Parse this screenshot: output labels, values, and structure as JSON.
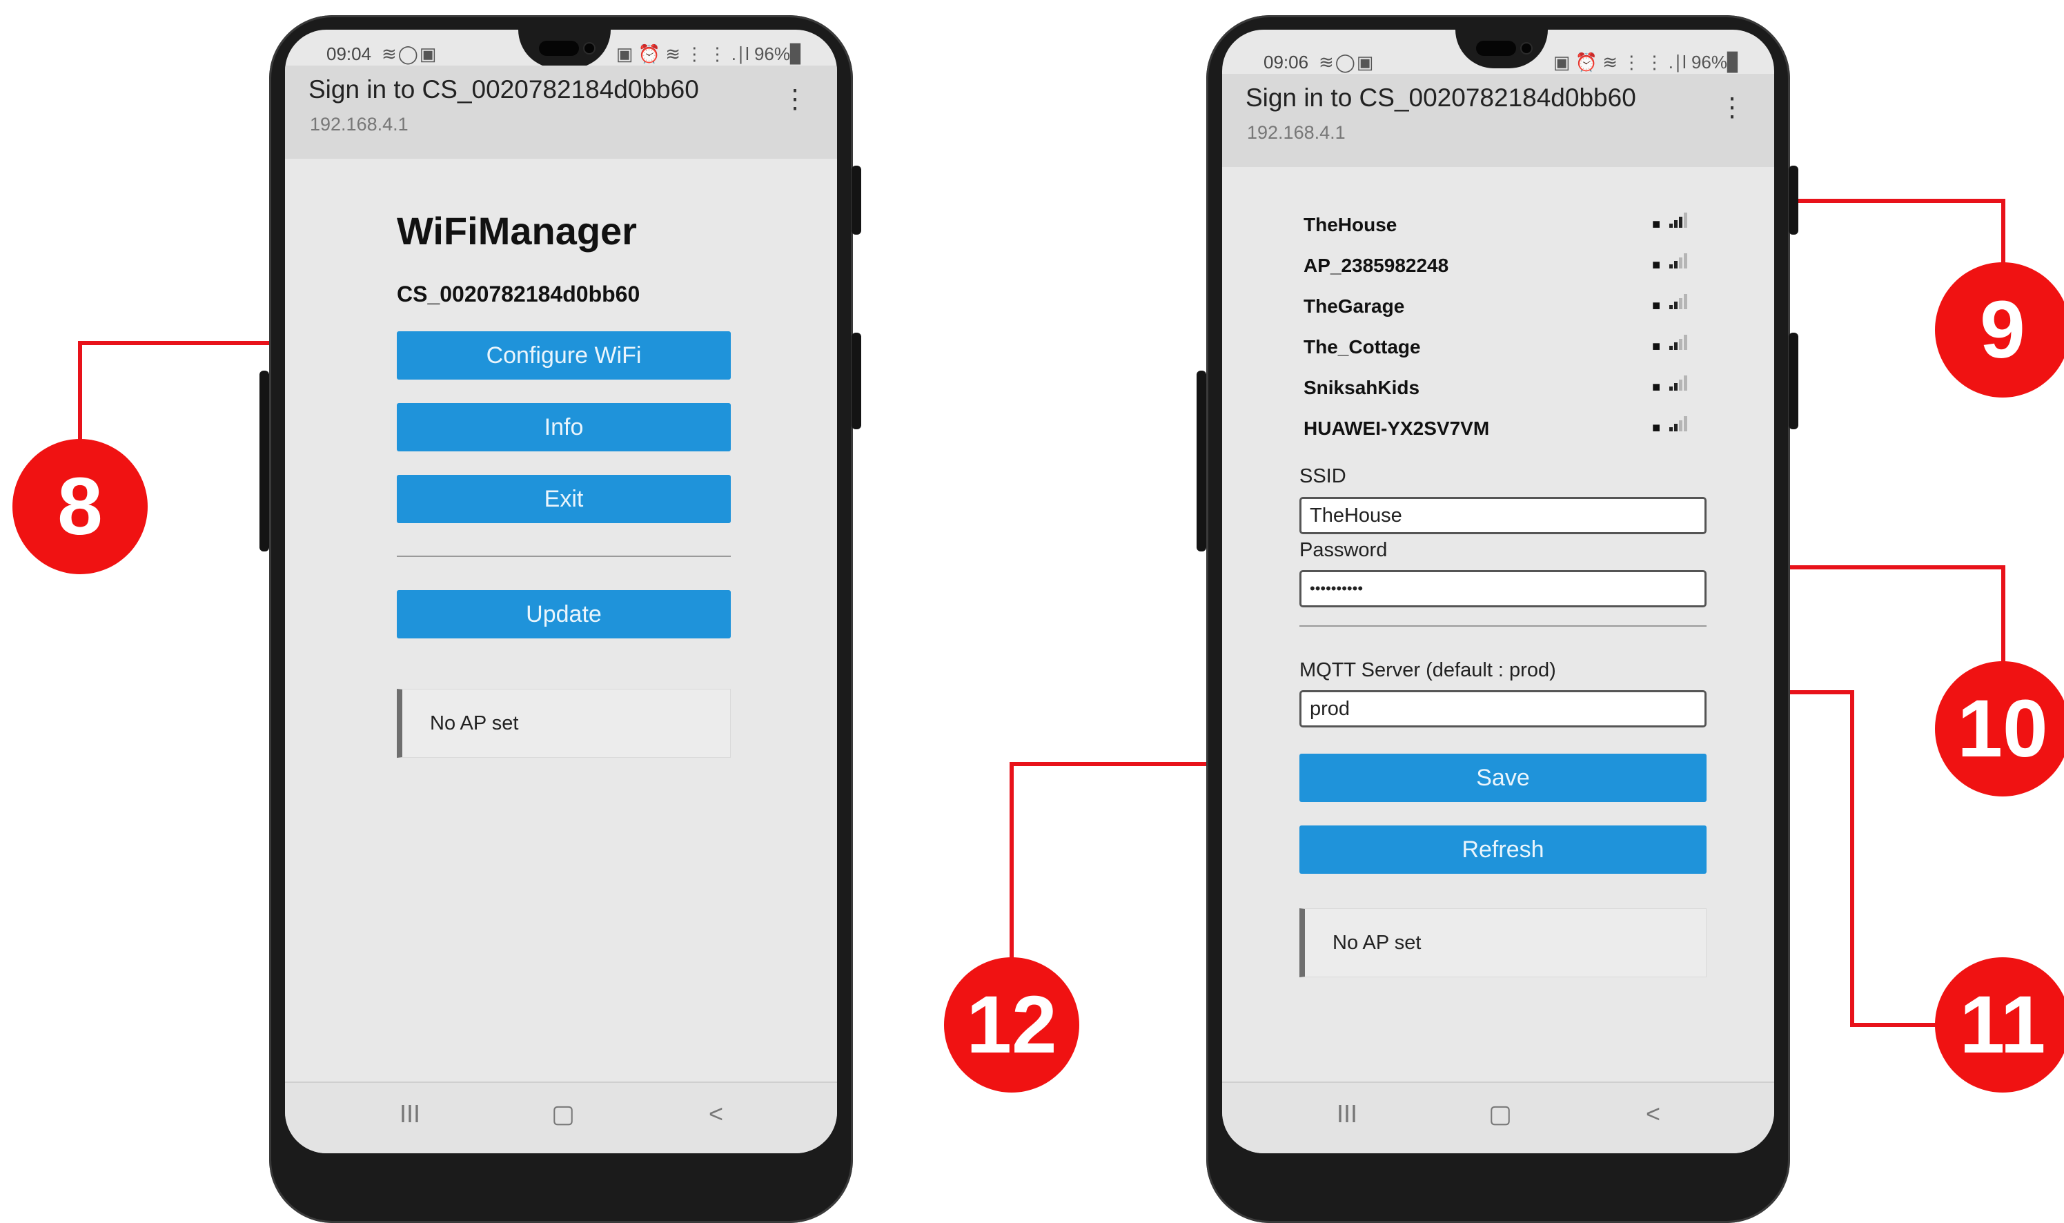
{
  "left_phone": {
    "status": {
      "time": "09:04",
      "icons_left": "≋◯▣",
      "icons_right": "▣ ⏰ ≋ ⋮ ⋮ .∣l 96%▊"
    },
    "address_bar": {
      "title": "Sign in to CS_0020782184d0bb60",
      "url": "192.168.4.1",
      "menu": "⋮"
    },
    "page": {
      "heading": "WiFiManager",
      "device_id": "CS_0020782184d0bb60",
      "buttons": {
        "configure": "Configure WiFi",
        "info": "Info",
        "exit": "Exit",
        "update": "Update"
      },
      "message": "No AP set"
    },
    "nav": {
      "recents": "III",
      "home": "▢",
      "back": "<"
    }
  },
  "right_phone": {
    "status": {
      "time": "09:06",
      "icons_left": "≋◯▣",
      "icons_right": "▣ ⏰ ≋ ⋮ ⋮ .∣l 96%▊"
    },
    "address_bar": {
      "title": "Sign in to CS_0020782184d0bb60",
      "url": "192.168.4.1",
      "menu": "⋮"
    },
    "networks": [
      {
        "name": "TheHouse",
        "signal_bars": 3
      },
      {
        "name": "AP_2385982248",
        "signal_bars": 2
      },
      {
        "name": "TheGarage",
        "signal_bars": 2
      },
      {
        "name": "The_Cottage",
        "signal_bars": 2
      },
      {
        "name": "SniksahKids",
        "signal_bars": 2
      },
      {
        "name": "HUAWEI-YX2SV7VM",
        "signal_bars": 2
      }
    ],
    "form": {
      "ssid_label": "SSID",
      "ssid_value": "TheHouse",
      "password_label": "Password",
      "password_value": "••••••••••",
      "mqtt_label": "MQTT Server (default : prod)",
      "mqtt_value": "prod",
      "save": "Save",
      "refresh": "Refresh"
    },
    "message": "No AP set",
    "nav": {
      "recents": "III",
      "home": "▢",
      "back": "<"
    }
  },
  "callouts": {
    "c8": "8",
    "c9": "9",
    "c10": "10",
    "c11": "11",
    "c12": "12"
  },
  "colors": {
    "accent_button": "#1f93da",
    "callout_red": "#f01212",
    "screen_bg": "#e8e8e8"
  }
}
